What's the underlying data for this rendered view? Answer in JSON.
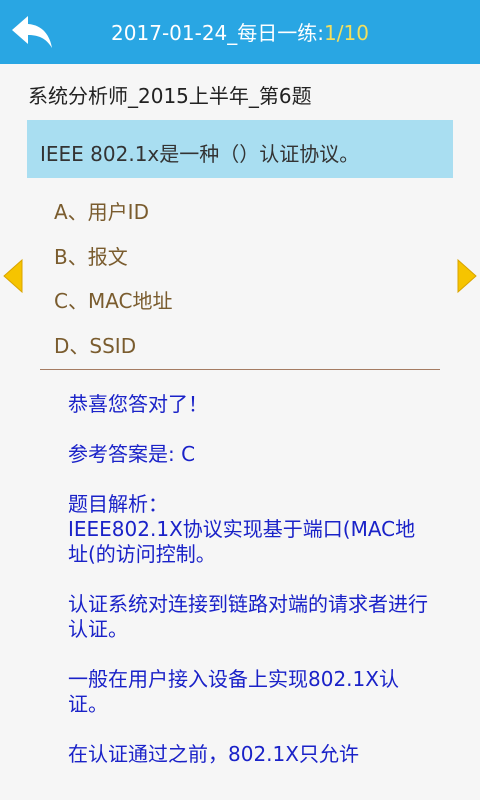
{
  "header": {
    "title_prefix": "2017-01-24_每日一练:",
    "page": "1/10",
    "back_icon": "back-arrow-icon"
  },
  "question": {
    "subject": "系统分析师_2015上半年_第6题",
    "text": "IEEE 802.1x是一种（）认证协议。"
  },
  "options": [
    "A、用户ID",
    "B、报文",
    "C、MAC地址",
    "D、SSID"
  ],
  "nav": {
    "prev_icon": "prev-arrow-icon",
    "next_icon": "next-arrow-icon",
    "arrow_color": "#f6c400"
  },
  "answer": {
    "result": "恭喜您答对了！",
    "correct": "参考答案是: C",
    "analysis_title": "题目解析：",
    "analysis_1": "IEEE802.1X协议实现基于端口(MAC地址(的访问控制。",
    "analysis_2": "认证系统对连接到链路对端的请求者进行认证。",
    "analysis_3": "一般在用户接入设备上实现802.1X认证。",
    "analysis_4": "在认证通过之前，802.1X只允许"
  }
}
